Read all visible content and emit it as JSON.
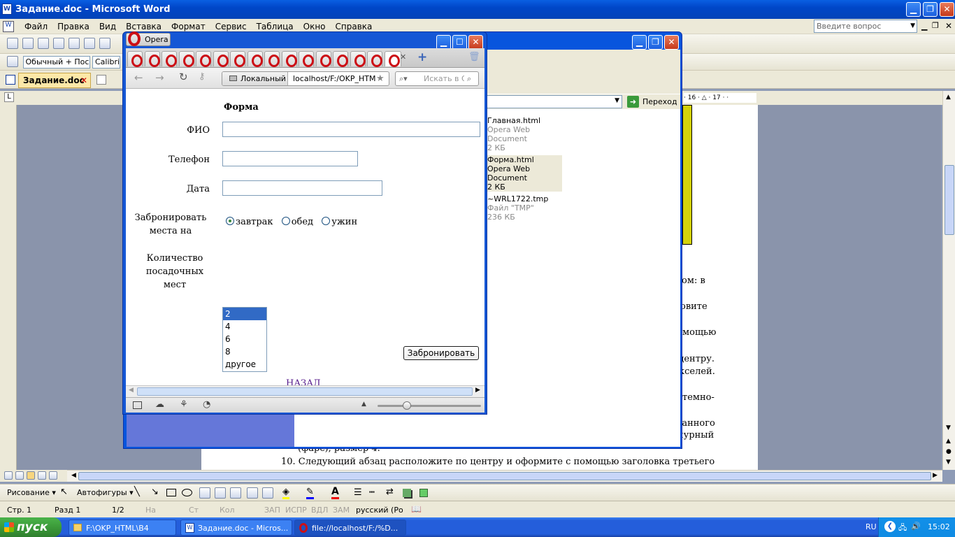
{
  "word": {
    "title": "Задание.doc - Microsoft Word",
    "menu": [
      "Файл",
      "Правка",
      "Вид",
      "Вставка",
      "Формат",
      "Сервис",
      "Таблица",
      "Окно",
      "Справка"
    ],
    "ask_placeholder": "Введите вопрос",
    "style_combo": "Обычный + Пос",
    "font_combo": "Calibri",
    "doc_tab": "Задание.doc",
    "doc_lines": {
      "l1": "ом: в",
      "l2": "овите",
      "l3": "мощью",
      "l4": "центру.",
      "l5": "кселей.",
      "l6": "темно-",
      "l7": "ванного",
      "l8": "пурный",
      "l9": "(фарс), размер 4.",
      "l10": "10. Следующий абзац расположите по центру и оформите с помощью заголовка третьего"
    },
    "drawing": {
      "drawing": "Рисование",
      "autoshapes": "Автофигуры"
    },
    "status": {
      "page": "Стр. 1",
      "section": "Разд 1",
      "pages": "1/2",
      "at": "На",
      "ln": "Ст",
      "col": "Кол",
      "rec": "ЗАП",
      "trk": "ИСПР",
      "ext": "ВДЛ",
      "ovr": "ЗАМ",
      "lang": "русский (Ро"
    }
  },
  "explorer": {
    "go_label": "Переход",
    "ruler_text": "· 16 · △ · 17 · ·",
    "files": [
      {
        "name": "Главная.html",
        "type": "Opera Web Document",
        "size": "2 КБ"
      },
      {
        "name": "Форма.html",
        "type": "Opera Web Document",
        "size": "2 КБ"
      },
      {
        "name": "~WRL1722.tmp",
        "type": "Файл \"TMP\"",
        "size": "236 КБ"
      }
    ]
  },
  "opera": {
    "menu_label": "Opera",
    "tab_count": 16,
    "address_chip": "Локальный",
    "address": "localhost/F:/OKP_HTML/",
    "search_placeholder": "Искать в Go",
    "page": {
      "heading": "Форма",
      "fio_label": "ФИО",
      "phone_label": "Телефон",
      "date_label": "Дата",
      "reserve_label": "Забронировать места на",
      "radios": [
        "завтрак",
        "обед",
        "ужин"
      ],
      "radio_selected": "завтрак",
      "seats_label": "Количество посадочных мест",
      "seats_options": [
        "2",
        "4",
        "6",
        "8",
        "другое"
      ],
      "seats_selected": "2",
      "submit": "Забронировать",
      "back_link": "НАЗАД"
    }
  },
  "taskbar": {
    "start": "пуск",
    "tasks": [
      "F:\\OKP_HTML\\B4",
      "Задание.doc - Micros...",
      "file://localhost/F:/%D..."
    ],
    "lang": "RU",
    "clock": "15:02"
  },
  "colors": {
    "xp_blue": "#0a5fe2",
    "start_green": "#3b9a39",
    "opera_red": "#cc0f16",
    "link": "#551a8b",
    "select": "#316ac5",
    "yellow_bar": "#d4d20a"
  }
}
